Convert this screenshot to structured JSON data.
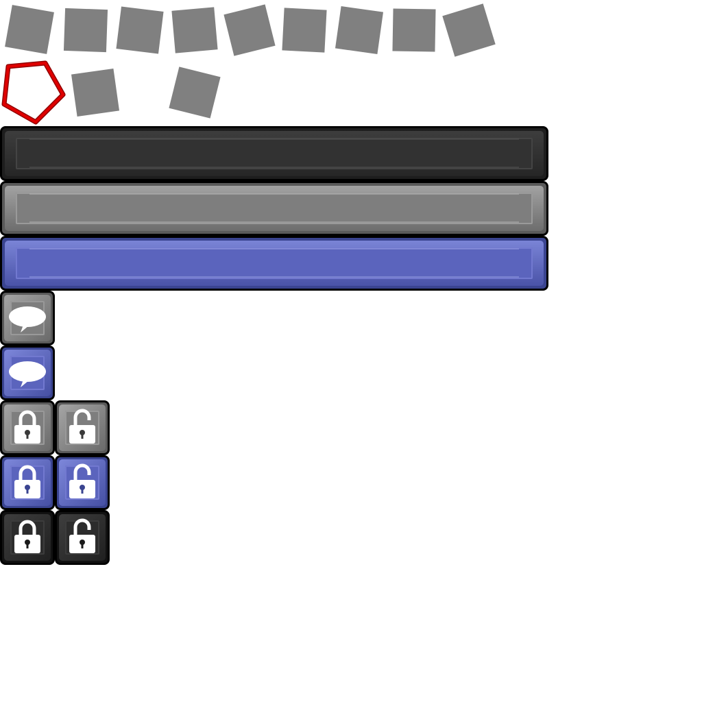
{
  "sprite_sheet": {
    "background": "#ffffff",
    "placeholder_color": "#808080",
    "pentagon_colors": {
      "outer": "#e00000",
      "inner": "#b00000"
    },
    "panel_colors": {
      "dark": "#323232",
      "grey": "#7e7e7e",
      "blue": "#5b64bd"
    },
    "icons": [
      "speech-bubble-icon",
      "lock-closed-icon",
      "lock-open-icon"
    ]
  }
}
